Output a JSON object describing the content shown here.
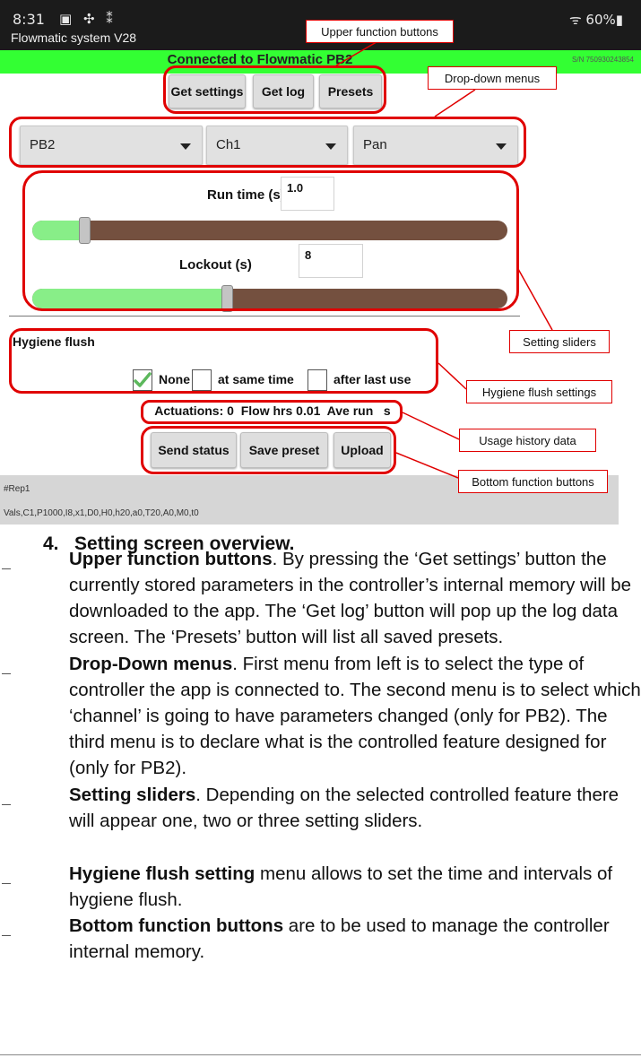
{
  "status_bar": {
    "time": "8:31",
    "icons": "▣ ✣ ⁑",
    "battery": "ᯤ 60%▮"
  },
  "app": {
    "title": "Flowmatic system V28",
    "connection": "Connected to Flowmatic PB2",
    "serial": "S/N 750930243854"
  },
  "upper_buttons": {
    "get_settings": "Get settings",
    "get_log": "Get log",
    "presets": "Presets"
  },
  "dropdowns": {
    "controller": "PB2",
    "channel": "Ch1",
    "feature": "Pan"
  },
  "sliders": {
    "run_time": {
      "label": "Run time (s)",
      "value": "1.0",
      "position": 0.11
    },
    "lockout": {
      "label": "Lockout (s)",
      "value": "8",
      "position": 0.41
    }
  },
  "hygiene": {
    "title": "Hygiene flush",
    "none_label": "None",
    "none_checked": true,
    "same_time_label": "at same time",
    "after_last_label": "after last use"
  },
  "usage": {
    "text": "Actuations: 0  Flow hrs 0.01  Ave run   s"
  },
  "bottom_buttons": {
    "send_status": "Send status",
    "save_preset": "Save preset",
    "upload": "Upload"
  },
  "log": {
    "line1": "#Rep1",
    "line2": "Vals,C1,P1000,I8,x1,D0,H0,h20,a0,T20,A0,M0,t0"
  },
  "callouts": {
    "upper": "Upper function buttons",
    "dropdown": "Drop-down menus",
    "sliders": "Setting sliders",
    "hygiene": "Hygiene flush settings",
    "usage": "Usage history data",
    "bottom": "Bottom function buttons"
  },
  "doc": {
    "heading_number": "4.",
    "heading": "Setting screen overview.",
    "items": [
      {
        "bold": "Upper function buttons",
        "text": ". By pressing the ‘Get settings’ button the currently stored parameters in the controller’s internal memory will be downloaded to the app. The ‘Get log’ button will pop up the log data screen. The ‘Presets’ button will list all saved presets."
      },
      {
        "bold": "Drop-Down menus",
        "text": ". First menu from left is to select the type of controller the app is connected to. The second menu is to select which ‘channel’ is going to have parameters changed (only for PB2). The third menu is to declare what is the controlled feature designed for (only for PB2)."
      },
      {
        "bold": "Setting sliders",
        "text": ". Depending on the selected controlled feature there will appear one, two or three setting sliders."
      },
      {
        "bold": "Hygiene flush setting",
        "text": " menu allows to set the time and intervals of hygiene flush."
      },
      {
        "bold": "Bottom function buttons",
        "text": " are to be used to manage the controller internal memory."
      }
    ]
  }
}
